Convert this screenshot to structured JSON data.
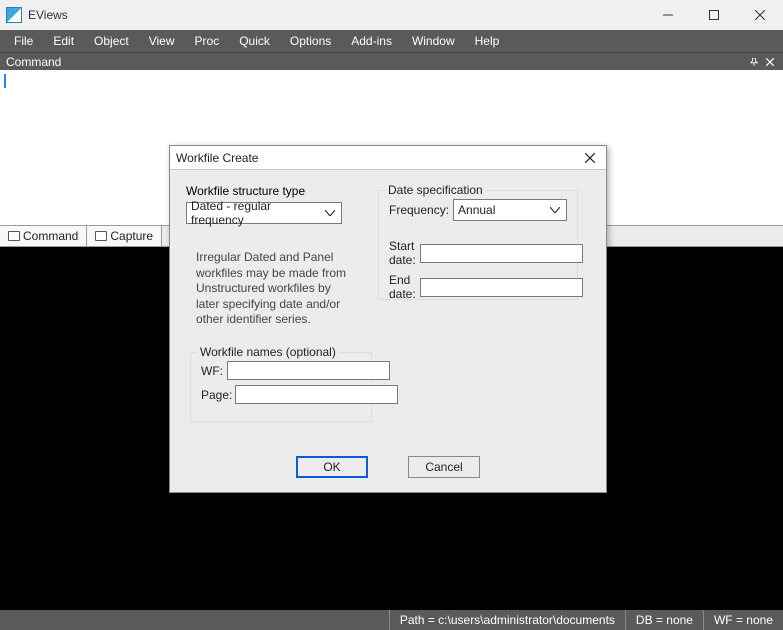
{
  "window": {
    "title": "EViews"
  },
  "menu": {
    "items": [
      "File",
      "Edit",
      "Object",
      "View",
      "Proc",
      "Quick",
      "Options",
      "Add-ins",
      "Window",
      "Help"
    ]
  },
  "command_panel": {
    "title": "Command"
  },
  "tabs": {
    "items": [
      "Command",
      "Capture"
    ]
  },
  "statusbar": {
    "path": "Path = c:\\users\\administrator\\documents",
    "db": "DB = none",
    "wf": "WF = none"
  },
  "dialog": {
    "title": "Workfile Create",
    "structure": {
      "label": "Workfile structure type",
      "value": "Dated - regular frequency"
    },
    "note": "Irregular Dated and Panel workfiles may be made from Unstructured workfiles by later specifying date and/or other identifier series.",
    "date_spec": {
      "legend": "Date specification",
      "frequency_label": "Frequency:",
      "frequency_value": "Annual",
      "start_label": "Start date:",
      "start_value": "",
      "end_label": "End date:",
      "end_value": ""
    },
    "names": {
      "legend": "Workfile names (optional)",
      "wf_label": "WF:",
      "wf_value": "",
      "page_label": "Page:",
      "page_value": ""
    },
    "buttons": {
      "ok": "OK",
      "cancel": "Cancel"
    }
  }
}
